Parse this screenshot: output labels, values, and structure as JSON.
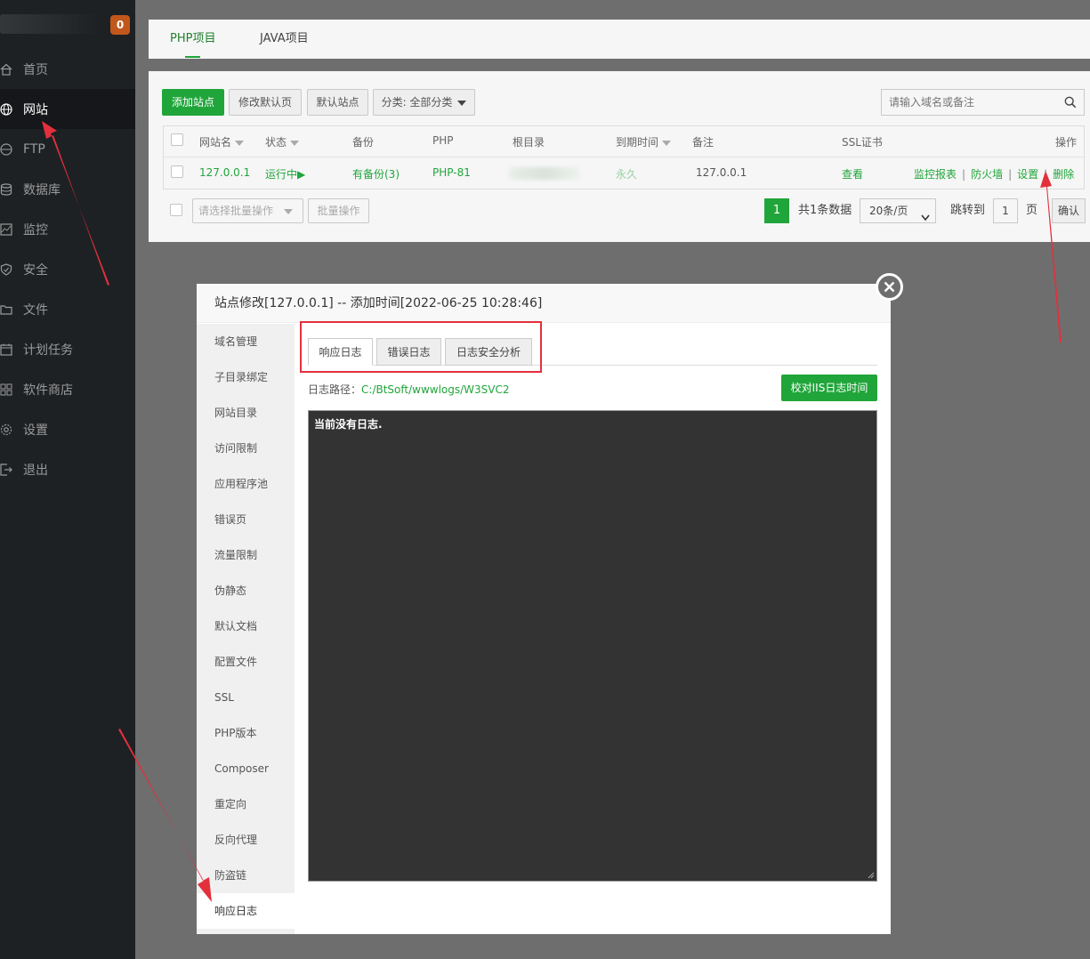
{
  "sidebar": {
    "badge": "0",
    "items": [
      {
        "label": "首页",
        "icon": "home-icon"
      },
      {
        "label": "网站",
        "icon": "globe-icon"
      },
      {
        "label": "FTP",
        "icon": "ftp-icon"
      },
      {
        "label": "数据库",
        "icon": "database-icon"
      },
      {
        "label": "监控",
        "icon": "monitor-icon"
      },
      {
        "label": "安全",
        "icon": "shield-icon"
      },
      {
        "label": "文件",
        "icon": "folder-icon"
      },
      {
        "label": "计划任务",
        "icon": "calendar-icon"
      },
      {
        "label": "软件商店",
        "icon": "grid-icon"
      },
      {
        "label": "设置",
        "icon": "gear-icon"
      },
      {
        "label": "退出",
        "icon": "logout-icon"
      }
    ],
    "active_index": 1
  },
  "main_tabs": [
    "PHP项目",
    "JAVA项目"
  ],
  "toolbar": {
    "add_site": "添加站点",
    "modify_default_page": "修改默认页",
    "default_site": "默认站点",
    "category": "分类: 全部分类",
    "search_placeholder": "请输入域名或备注"
  },
  "table": {
    "headers": [
      "网站名",
      "状态",
      "备份",
      "PHP",
      "根目录",
      "到期时间",
      "备注",
      "SSL证书",
      "操作"
    ],
    "row": {
      "name": "127.0.0.1",
      "status": "运行中▶",
      "backup": "有备份(3)",
      "php": "PHP-81",
      "expire": "永久",
      "remark": "127.0.0.1",
      "ssl": "查看",
      "actions": [
        "监控报表",
        "防火墙",
        "设置",
        "删除"
      ]
    }
  },
  "batch": {
    "select_placeholder": "请选择批量操作",
    "batch_button": "批量操作"
  },
  "pager": {
    "current": "1",
    "total": "共1条数据",
    "per_page": "20条/页",
    "jump_label": "跳转到",
    "jump_value": "1",
    "page_suffix": "页",
    "confirm": "确认"
  },
  "modal": {
    "title": "站点修改[127.0.0.1] -- 添加时间[2022-06-25 10:28:46]",
    "menu": [
      "域名管理",
      "子目录绑定",
      "网站目录",
      "访问限制",
      "应用程序池",
      "错误页",
      "流量限制",
      "伪静态",
      "默认文档",
      "配置文件",
      "SSL",
      "PHP版本",
      "Composer",
      "重定向",
      "反向代理",
      "防盗链",
      "响应日志"
    ],
    "active_menu_index": 16,
    "log_tabs": [
      "响应日志",
      "错误日志",
      "日志安全分析"
    ],
    "log_path_label": "日志路径：",
    "log_path": "C:/BtSoft/wwwlogs/W3SVC2",
    "calibrate_button": "校对IIS日志时间",
    "log_content": "当前没有日志."
  },
  "colors": {
    "accent": "#20a53a",
    "sidebar_bg": "#1e2124",
    "highlight": "#e3303b"
  }
}
